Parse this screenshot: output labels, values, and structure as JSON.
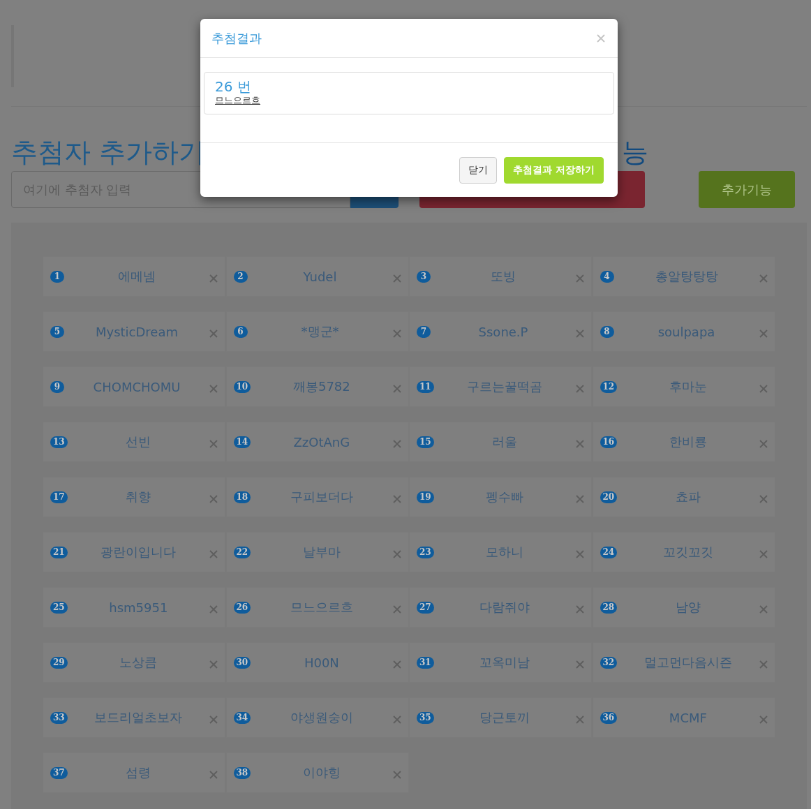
{
  "page": {
    "heading": "추첨자 추가하기",
    "heading_2": "능",
    "input": {
      "placeholder": "여기에 추첨자 입력"
    },
    "extra_button": "추가기능"
  },
  "participants": [
    {
      "number": "1",
      "name": "에메넴"
    },
    {
      "number": "2",
      "name": "Yudel"
    },
    {
      "number": "3",
      "name": "또빙"
    },
    {
      "number": "4",
      "name": "총알탕탕탕"
    },
    {
      "number": "5",
      "name": "MysticDream"
    },
    {
      "number": "6",
      "name": "*맹군*"
    },
    {
      "number": "7",
      "name": "Ssone.P"
    },
    {
      "number": "8",
      "name": "soulpapa"
    },
    {
      "number": "9",
      "name": "CHOMCHOMU"
    },
    {
      "number": "10",
      "name": "깨봉5782"
    },
    {
      "number": "11",
      "name": "구르는꿀떡곰"
    },
    {
      "number": "12",
      "name": "후마눈"
    },
    {
      "number": "13",
      "name": "선빈"
    },
    {
      "number": "14",
      "name": "ZzOtAnG"
    },
    {
      "number": "15",
      "name": "러울"
    },
    {
      "number": "16",
      "name": "한비룡"
    },
    {
      "number": "17",
      "name": "취향"
    },
    {
      "number": "18",
      "name": "구피보더다"
    },
    {
      "number": "19",
      "name": "펭수빠"
    },
    {
      "number": "20",
      "name": "쵸파"
    },
    {
      "number": "21",
      "name": "광란이입니다"
    },
    {
      "number": "22",
      "name": "날부마"
    },
    {
      "number": "23",
      "name": "모하니"
    },
    {
      "number": "24",
      "name": "꼬깃꼬깃"
    },
    {
      "number": "25",
      "name": "hsm5951"
    },
    {
      "number": "26",
      "name": "므느으르흐"
    },
    {
      "number": "27",
      "name": "다람쥐야"
    },
    {
      "number": "28",
      "name": "남양"
    },
    {
      "number": "29",
      "name": "노상큼"
    },
    {
      "number": "30",
      "name": "H00N"
    },
    {
      "number": "31",
      "name": "꼬옥미남"
    },
    {
      "number": "32",
      "name": "멀고먼다음시즌"
    },
    {
      "number": "33",
      "name": "보드리얼초보자"
    },
    {
      "number": "34",
      "name": "야생원숭이"
    },
    {
      "number": "35",
      "name": "당근토끼"
    },
    {
      "number": "36",
      "name": "MCMF"
    },
    {
      "number": "37",
      "name": "섬령"
    },
    {
      "number": "38",
      "name": "이야힝"
    }
  ],
  "modal": {
    "title": "추첨결과",
    "result_number": "26 번",
    "result_name": "므느으르흐",
    "buttons": [
      {
        "label": "닫기",
        "kind": "default"
      },
      {
        "label": "추첨결과 저장하기",
        "kind": "primary"
      }
    ]
  }
}
